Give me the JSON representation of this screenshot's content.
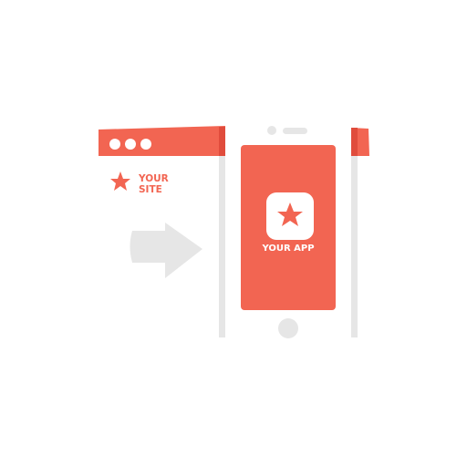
{
  "colors": {
    "accent": "#f26552",
    "accent_dark": "#e04c3c",
    "gray": "#e6e6e6",
    "white": "#ffffff"
  },
  "site": {
    "label_line1": "YOUR",
    "label_line2": "SITE",
    "icon": "star-icon"
  },
  "app": {
    "label": "YOUR APP",
    "icon": "star-icon"
  },
  "arrow": {
    "icon": "arrow-right-icon"
  }
}
